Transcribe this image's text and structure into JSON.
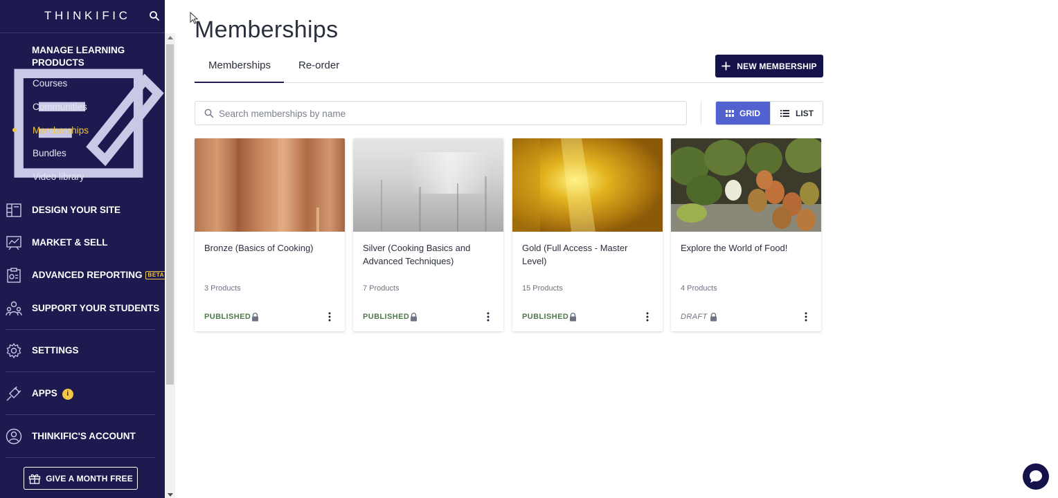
{
  "brand": "THINKIFIC",
  "sidebar": {
    "sections": [
      {
        "label": "MANAGE LEARNING PRODUCTS",
        "icon": "manage-products-icon"
      },
      {
        "label": "DESIGN YOUR SITE",
        "icon": "design-layout-icon"
      },
      {
        "label": "MARKET & SELL",
        "icon": "market-chart-icon"
      },
      {
        "label": "ADVANCED REPORTING",
        "icon": "reporting-icon",
        "badge": "BETA"
      },
      {
        "label": "SUPPORT YOUR STUDENTS",
        "icon": "students-icon"
      },
      {
        "label": "SETTINGS",
        "icon": "gear-icon"
      },
      {
        "label": "APPS",
        "icon": "plug-icon",
        "badge": "i"
      },
      {
        "label": "THINKIFIC'S ACCOUNT",
        "icon": "account-icon"
      }
    ],
    "sub_items": [
      "Courses",
      "Communities",
      "Memberships",
      "Bundles",
      "Video library"
    ],
    "active_sub_item": "Memberships",
    "give_button": "GIVE A MONTH FREE"
  },
  "main": {
    "title": "Memberships",
    "tabs": [
      {
        "label": "Memberships"
      },
      {
        "label": "Re-order"
      }
    ],
    "new_button": "NEW MEMBERSHIP",
    "search_placeholder": "Search memberships by name",
    "view": {
      "grid": "GRID",
      "list": "LIST",
      "selected": "GRID"
    },
    "cards": [
      {
        "title": "Bronze (Basics of Cooking)",
        "products": "3 Products",
        "status": "PUBLISHED"
      },
      {
        "title": "Silver (Cooking Basics and Advanced Techniques)",
        "products": "7 Products",
        "status": "PUBLISHED"
      },
      {
        "title": "Gold (Full Access - Master Level)",
        "products": "15 Products",
        "status": "PUBLISHED"
      },
      {
        "title": "Explore the World of Food!",
        "products": "4 Products",
        "status": "DRAFT"
      }
    ]
  },
  "colors": {
    "sidebar_bg": "#1d1a4f",
    "accent_yellow": "#f3c643",
    "primary_button": "#15124a",
    "grid_toggle": "#5162d0",
    "published_green": "#4e7a4a"
  }
}
